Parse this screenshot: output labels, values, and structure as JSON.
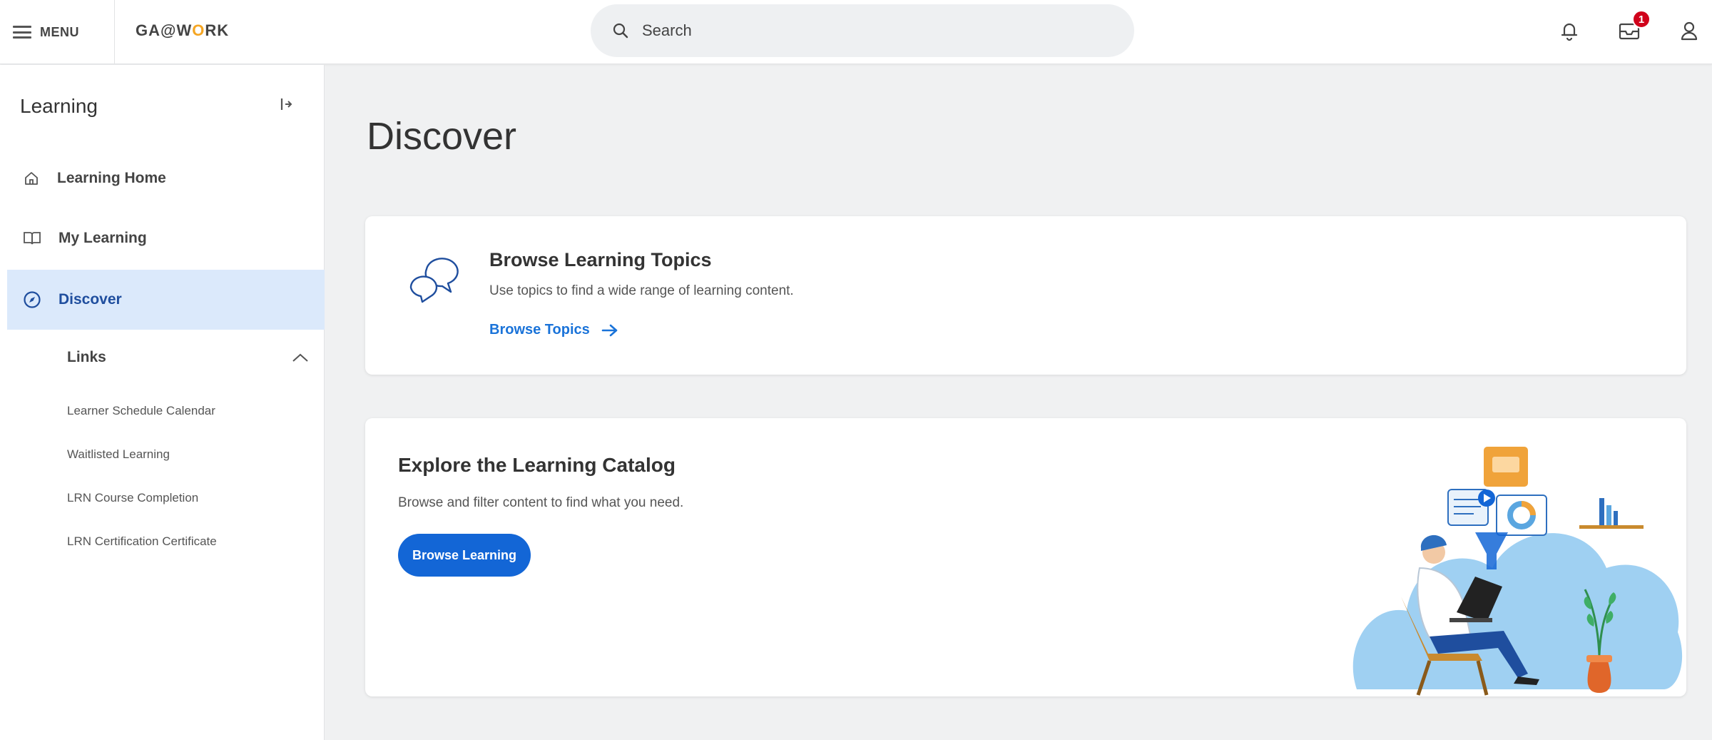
{
  "topbar": {
    "menu_label": "MENU",
    "logo_prefix": "GA@W",
    "logo_o": "O",
    "logo_suffix": "RK",
    "search_placeholder": "Search",
    "icons": [
      "notifications-bell-icon",
      "inbox-icon",
      "user-profile-icon"
    ],
    "inbox_badge": "1",
    "badge_color": "#d0021b"
  },
  "sidebar": {
    "title": "Learning",
    "collapse_icon": "collapse-panel-icon",
    "items": [
      {
        "label": "Learning Home",
        "icon": "home-icon",
        "active": false
      },
      {
        "label": "My Learning",
        "icon": "book-icon",
        "active": false
      },
      {
        "label": "Discover",
        "icon": "compass-icon",
        "active": true
      }
    ],
    "links_section": {
      "title": "Links",
      "expanded": true,
      "items": [
        "Learner Schedule Calendar",
        "Waitlisted Learning",
        "LRN Course Completion",
        "LRN Certification Certificate"
      ]
    }
  },
  "main": {
    "title": "Discover",
    "cards": [
      {
        "title": "Browse Learning Topics",
        "description": "Use topics to find a wide range of learning content.",
        "link_label": "Browse Topics",
        "icon": "chat-bubbles-icon"
      },
      {
        "title": "Explore the Learning Catalog",
        "description": "Browse and filter content to find what you need.",
        "button_label": "Browse Learning",
        "illustration": "person-learning-illustration"
      }
    ]
  },
  "colors": {
    "accent": "#1366d6",
    "link": "#1a73d9",
    "active_nav_bg": "#dbe9fb",
    "page_bg": "#f0f1f2"
  }
}
